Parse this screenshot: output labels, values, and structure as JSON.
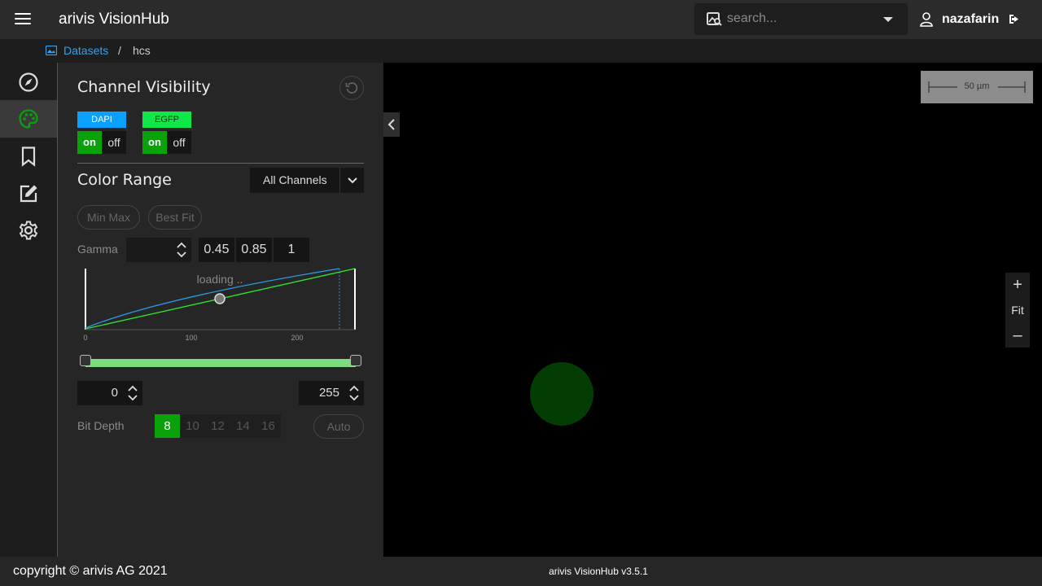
{
  "header": {
    "app_title": "arivis VisionHub",
    "search_placeholder": "search...",
    "username": "nazafarin"
  },
  "breadcrumb": {
    "root": "Datasets",
    "separator": "/",
    "current": "hcs"
  },
  "rail": {
    "items": [
      "compass-icon",
      "palette-icon",
      "bookmark-icon",
      "edit-icon",
      "gear-icon"
    ],
    "active_index": 1
  },
  "panel": {
    "channel_visibility_title": "Channel Visibility",
    "channels": [
      {
        "name": "DAPI",
        "color": "#0aa0ff",
        "on_label": "on",
        "off_label": "off",
        "state": "on"
      },
      {
        "name": "EGFP",
        "color": "#10e84a",
        "on_label": "on",
        "off_label": "off",
        "state": "on"
      }
    ],
    "color_range_title": "Color Range",
    "channel_select": "All Channels",
    "min_max_label": "Min Max",
    "best_fit_label": "Best Fit",
    "gamma_label": "Gamma",
    "gamma_value": "",
    "gamma_presets": [
      "0.45",
      "0.85",
      "1"
    ],
    "histogram": {
      "loading_text": "loading ..",
      "ticks": [
        "0",
        "100",
        "200"
      ]
    },
    "range_min": "0",
    "range_max": "255",
    "bit_depth_label": "Bit Depth",
    "bit_depths": [
      "8",
      "10",
      "12",
      "14",
      "16"
    ],
    "bit_depth_active": "8",
    "auto_label": "Auto"
  },
  "viewer": {
    "scalebar_label": "50 µm",
    "zoom_in": "+",
    "fit": "Fit",
    "zoom_out": "–"
  },
  "footer": {
    "copyright": "copyright © arivis AG 2021",
    "version": "arivis VisionHub v3.5.1"
  },
  "colors": {
    "accent_green": "#0aa20a",
    "link_blue": "#3aa0e8",
    "dapi_blue": "#0aa0ff",
    "egfp_green": "#10e84a"
  }
}
